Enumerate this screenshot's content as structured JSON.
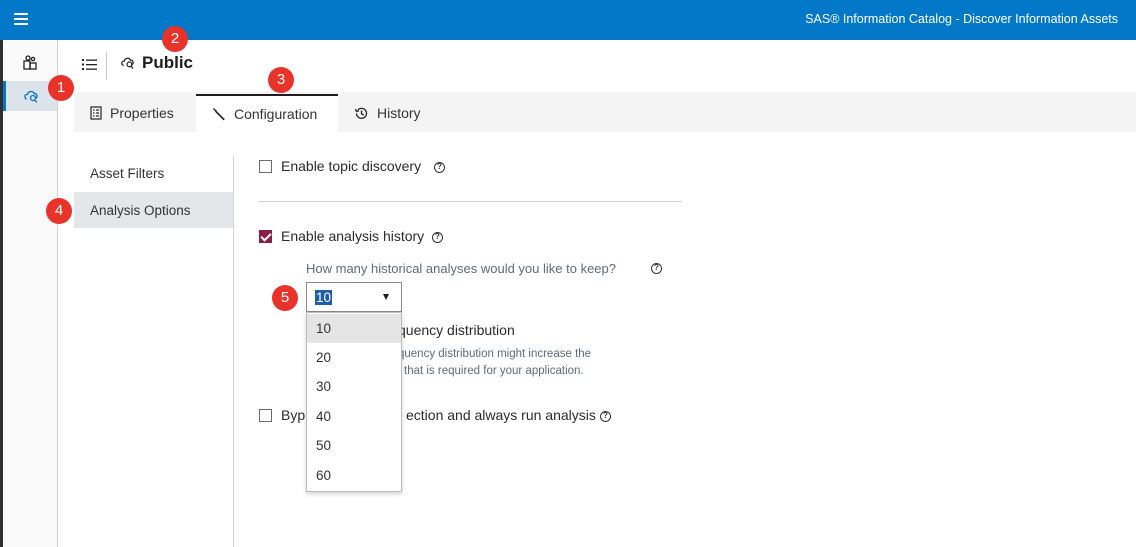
{
  "app": {
    "title": "SAS® Information Catalog - Discover Information Assets"
  },
  "header": {
    "title": "Public"
  },
  "tabs": [
    {
      "label": "Properties",
      "icon": "properties-icon"
    },
    {
      "label": "Configuration",
      "icon": "wrench-icon",
      "selected": true
    },
    {
      "label": "History",
      "icon": "history-icon"
    }
  ],
  "subnav": {
    "items": [
      {
        "label": "Asset Filters"
      },
      {
        "label": "Analysis Options",
        "selected": true
      }
    ]
  },
  "options": {
    "topic_discovery": {
      "label": "Enable topic discovery",
      "checked": false
    },
    "analysis_history": {
      "label": "Enable analysis history",
      "checked": true
    },
    "history_question": "How many historical analyses would you like to keep?",
    "history_select": {
      "value": "10",
      "options": [
        "10",
        "20",
        "30",
        "40",
        "50",
        "60"
      ]
    },
    "freq_label_partial": "quency distribution",
    "freq_note_line1": "quency distribution might increase the",
    "freq_note_line2": "that is required for your application.",
    "bypass_prefix": "Byp",
    "bypass_suffix": "ection and always run analysis",
    "help_glyph": "?"
  },
  "callouts": [
    "1",
    "2",
    "3",
    "4",
    "5"
  ],
  "colors": {
    "topbar": "#0478c8",
    "checkbox_checked": "#8a1c46",
    "callout": "#e8332b",
    "select_highlight": "#1f5fa8"
  }
}
